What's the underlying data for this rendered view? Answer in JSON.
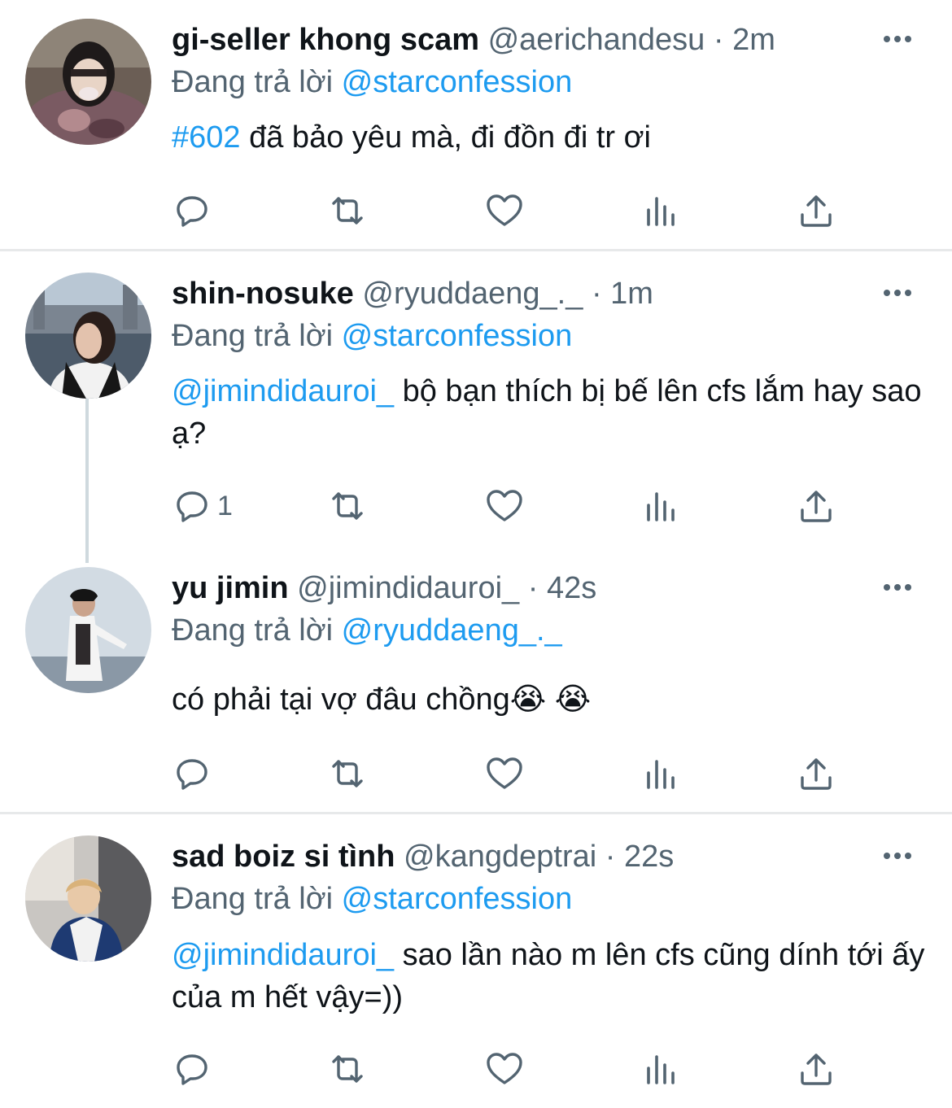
{
  "tweets": [
    {
      "name": "gi-seller khong scam",
      "handle": "@aerichandesu",
      "dot": "·",
      "time": "2m",
      "replying_prefix": "Đang trả lời",
      "replying_to": "@starconfession",
      "body_link": "#602",
      "body_text": " đã bảo yêu mà, đi đồn đi tr ơi",
      "reply_count": ""
    },
    {
      "name": "shin-nosuke",
      "handle": "@ryuddaeng_._",
      "dot": "·",
      "time": "1m",
      "replying_prefix": "Đang trả lời",
      "replying_to": "@starconfession",
      "body_link": "@jimindidauroi_",
      "body_text": " bộ bạn thích bị bế lên cfs lắm hay sao ạ?",
      "reply_count": "1"
    },
    {
      "name": "yu jimin",
      "handle": "@jimindidauroi_",
      "dot": "·",
      "time": "42s",
      "replying_prefix": "Đang trả lời",
      "replying_to": "@ryuddaeng_._",
      "body_link": "",
      "body_text": "có phải tại vợ đâu chồng😭 😭",
      "reply_count": ""
    },
    {
      "name": "sad boiz si tình",
      "handle": "@kangdeptrai",
      "dot": "·",
      "time": "22s",
      "replying_prefix": "Đang trả lời",
      "replying_to": "@starconfession",
      "body_link": "@jimindidauroi_",
      "body_text": " sao lần nào m lên cfs cũng dính tới ấy của m hết vậy=))",
      "reply_count": ""
    }
  ],
  "colors": {
    "link": "#1d9bf0",
    "secondary": "#536471",
    "text": "#0f1419",
    "divider": "#e7e9ea"
  },
  "icons": [
    "reply-icon",
    "retweet-icon",
    "like-icon",
    "views-icon",
    "share-icon",
    "more-icon"
  ]
}
